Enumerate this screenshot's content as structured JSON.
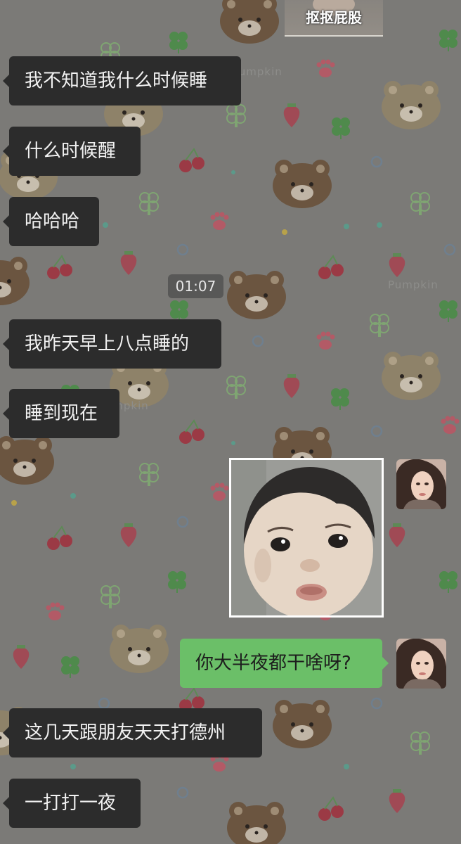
{
  "wallpaper": {
    "watermark": "Pumpkin"
  },
  "top_sticker": {
    "caption": "抠抠屁股"
  },
  "messages_before_time": [
    {
      "text": "我不知道我什么时候睡"
    },
    {
      "text": "什么时候醒"
    },
    {
      "text": "哈哈哈"
    }
  ],
  "timestamp": "01:07",
  "messages_after_time": [
    {
      "text": "我昨天早上八点睡的"
    },
    {
      "text": "睡到现在"
    }
  ],
  "outgoing": {
    "sticker": "baby-pout-sticker",
    "text": "你大半夜都干啥呀?"
  },
  "messages_last": [
    {
      "text": "这几天跟朋友天天打德州"
    },
    {
      "text": "一打打一夜"
    }
  ],
  "colors": {
    "incoming_bubble": "#2c2c2c",
    "outgoing_bubble": "#6bbf68",
    "wallpaper": "#7b7a77"
  }
}
